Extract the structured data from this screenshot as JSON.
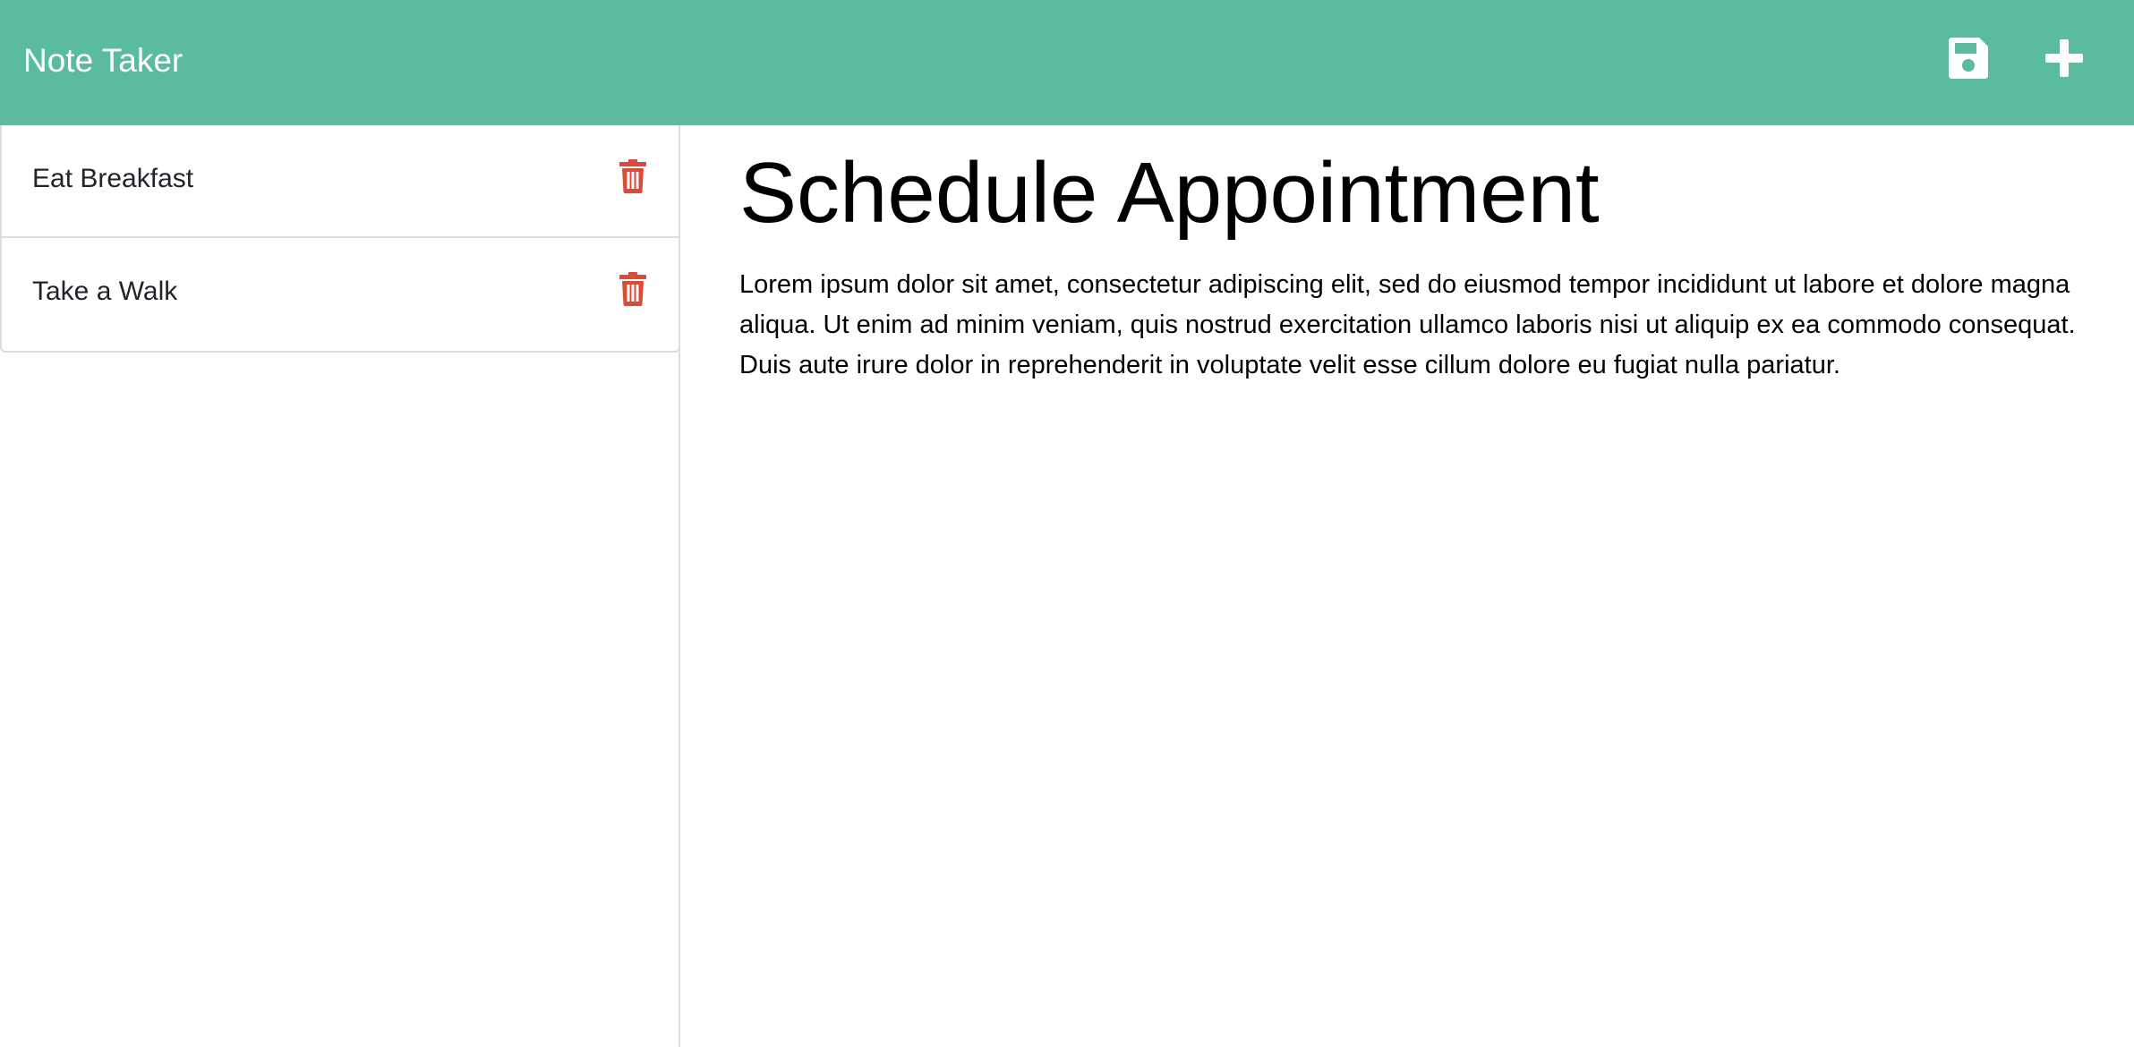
{
  "header": {
    "brand": "Note Taker",
    "save_icon": "save-icon",
    "new_icon": "plus-icon",
    "background_color": "#5abb9f",
    "text_color": "#ffffff"
  },
  "sidebar": {
    "notes": [
      {
        "title": "Eat Breakfast",
        "icon": "trash-icon"
      },
      {
        "title": "Take a Walk",
        "icon": "trash-icon"
      }
    ],
    "delete_color": "#dc4a38"
  },
  "editor": {
    "title": "Schedule Appointment",
    "body": "Lorem ipsum dolor sit amet, consectetur adipiscing elit, sed do eiusmod tempor incididunt ut labore et dolore magna aliqua. Ut enim ad minim veniam, quis nostrud exercitation ullamco laboris nisi ut aliquip ex ea commodo consequat. Duis aute irure dolor in reprehenderit in voluptate velit esse cillum dolore eu fugiat nulla pariatur."
  }
}
